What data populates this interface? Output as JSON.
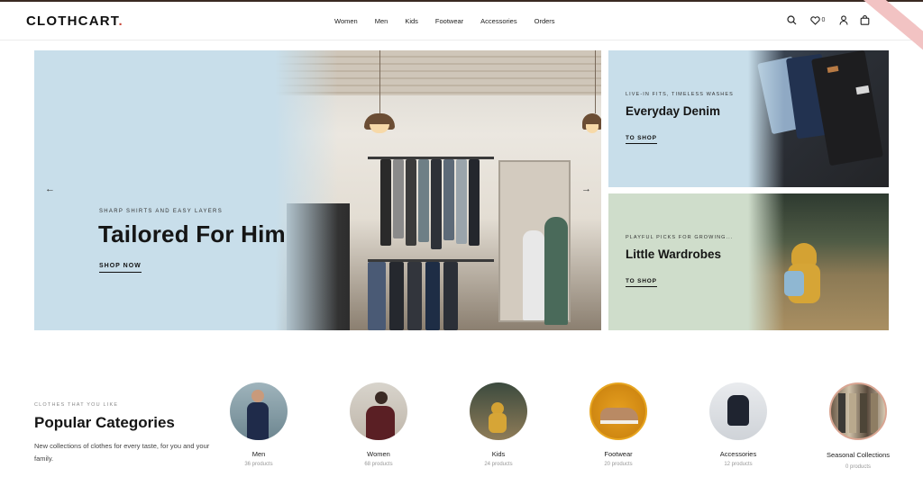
{
  "brand": {
    "name": "CLOTHCART",
    "dot": "."
  },
  "nav": {
    "items": [
      "Women",
      "Men",
      "Kids",
      "Footwear",
      "Accessories",
      "Orders"
    ]
  },
  "header_icons": {
    "search": "search-icon",
    "wishlist": "heart-icon",
    "wishlist_count": "0",
    "account": "user-icon",
    "cart": "bag-icon"
  },
  "hero": {
    "subtitle": "SHARP SHIRTS AND EASY LAYERS",
    "title": "Tailored For Him",
    "button": "SHOP NOW"
  },
  "promos": [
    {
      "subtitle": "LIVE-IN FITS, TIMELESS WASHES",
      "title": "Everyday Denim",
      "button": "TO SHOP"
    },
    {
      "subtitle": "PLAYFUL PICKS FOR GROWING...",
      "title": "Little Wardrobes",
      "button": "TO SHOP"
    }
  ],
  "categories_section": {
    "subtitle": "CLOTHES THAT YOU LIKE",
    "title": "Popular Categories",
    "description": "New collections of clothes for every taste, for you and your family."
  },
  "categories": [
    {
      "name": "Men",
      "count": "36 products"
    },
    {
      "name": "Women",
      "count": "68 products"
    },
    {
      "name": "Kids",
      "count": "24 products"
    },
    {
      "name": "Footwear",
      "count": "20 products"
    },
    {
      "name": "Accessories",
      "count": "12 products"
    },
    {
      "name": "Seasonal Collections",
      "count": "0 products"
    }
  ],
  "colors": {
    "accent": "#c9493a",
    "hero_bg": "#c8deea",
    "kids_bg": "#cfddcb"
  }
}
